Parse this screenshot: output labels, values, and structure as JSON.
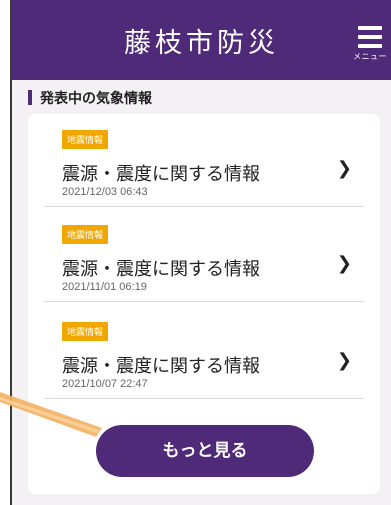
{
  "header": {
    "title": "藤枝市防災",
    "menu_label": "メニュー"
  },
  "section": {
    "title": "発表中の気象情報"
  },
  "items": [
    {
      "badge": "地震情報",
      "title": "震源・震度に関する情報",
      "date": "2021/12/03 06:43"
    },
    {
      "badge": "地震情報",
      "title": "震源・震度に関する情報",
      "date": "2021/11/01 06:19"
    },
    {
      "badge": "地震情報",
      "title": "震源・震度に関する情報",
      "date": "2021/10/07 22:47"
    }
  ],
  "more_button": {
    "label": "もっと見る"
  },
  "colors": {
    "brand": "#4e2a78",
    "badge": "#f0a800",
    "callout": "#f3b060"
  },
  "icons": {
    "menu": "hamburger-menu-icon",
    "chevron": "chevron-right-icon"
  }
}
